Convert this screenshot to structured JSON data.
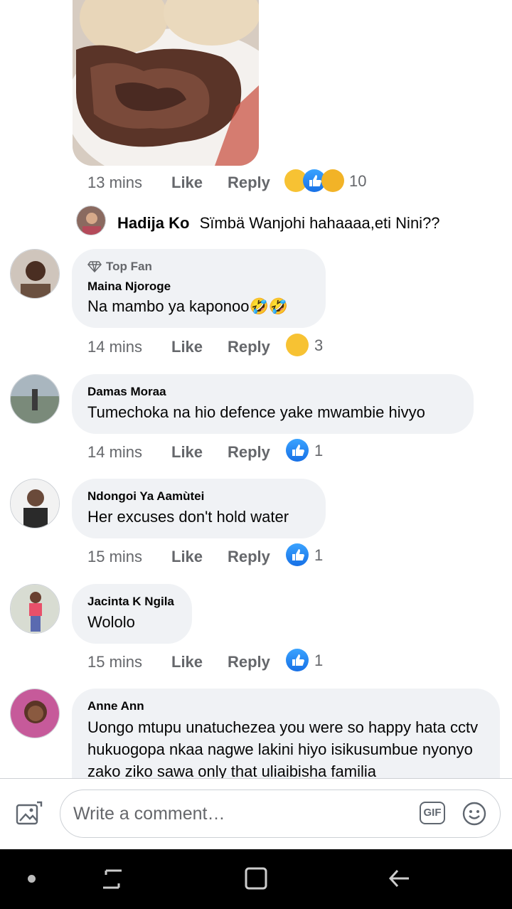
{
  "post_image": {
    "icon": "food-photo"
  },
  "first_meta": {
    "time": "13 mins",
    "like": "Like",
    "reply": "Reply",
    "reaction_count": "10"
  },
  "reply_line": {
    "name": "Hadija Ko",
    "text": "Sïmbä Wanjohi hahaaaa,eti Nini??"
  },
  "comments": [
    {
      "badge": "Top Fan",
      "name": "Maina Njoroge",
      "text": "Na mambo ya kaponoo🤣🤣",
      "time": "14 mins",
      "like": "Like",
      "reply": "Reply",
      "reaction_count": "3",
      "reaction": "haha"
    },
    {
      "name": "Damas Moraa",
      "text": "Tumechoka na hio defence yake mwambie hivyo",
      "time": "14 mins",
      "like": "Like",
      "reply": "Reply",
      "reaction_count": "1",
      "reaction": "like"
    },
    {
      "name": "Ndongoi Ya Aamùtei",
      "text": "Her excuses don't hold water",
      "time": "15 mins",
      "like": "Like",
      "reply": "Reply",
      "reaction_count": "1",
      "reaction": "like"
    },
    {
      "name": "Jacinta K Ngila",
      "text": "Wololo",
      "time": "15 mins",
      "like": "Like",
      "reply": "Reply",
      "reaction_count": "1",
      "reaction": "like"
    },
    {
      "name": "Anne Ann",
      "text": "Uongo mtupu unatuchezea you were so happy hata cctv hukuogopa nkaa nagwe lakini hiyo isikusumbue nyonyo zako ziko sawa only that uliaibisha familia"
    }
  ],
  "composer": {
    "placeholder": "Write a comment…",
    "gif_label": "GIF"
  },
  "colors": {
    "like_blue": "#1877f2",
    "haha_yellow": "#f7c233",
    "bubble_bg": "#f0f2f5",
    "meta_gray": "#65676b"
  }
}
